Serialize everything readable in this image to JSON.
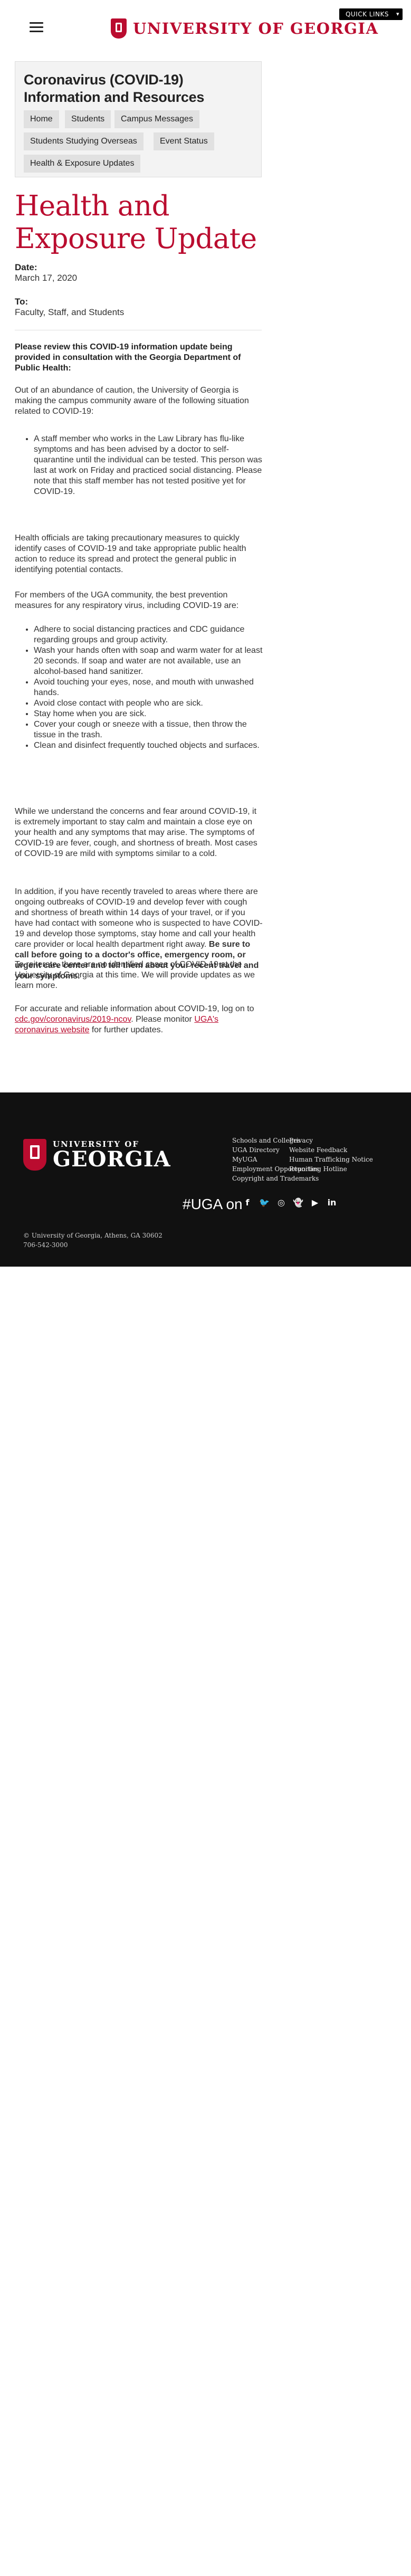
{
  "header": {
    "quick_links": "QUICK LINKS",
    "quick_links_arrow": "▾",
    "logo_text": "UNIVERSITY OF GEORGIA"
  },
  "section_nav": {
    "title": "Coronavirus (COVID-19) Information and Resources",
    "items": [
      {
        "label": "Home"
      },
      {
        "label": "Students"
      },
      {
        "label": "Campus Messages"
      },
      {
        "label": "Students Studying Overseas"
      },
      {
        "label": "Event Status"
      },
      {
        "label": "Health & Exposure Updates"
      }
    ]
  },
  "article": {
    "title": "Health and Exposure Update",
    "date_label": "Date:",
    "date_value": "March 17, 2020",
    "to_label": "To:",
    "to_value": "Faculty, Staff, and Students",
    "intro_bold": "Please review this COVID-19 information update being provided in consultation with the Georgia Department of Public Health:",
    "p1": "Out of an abundance of caution, the University of Georgia is making the campus community aware of the following situation related to COVID-19:",
    "bullet1": "A staff member who works in the Law Library has flu-like symptoms and has been advised by a doctor to self-quarantine until the individual can be tested. This person was last at work on Friday and practiced social distancing. Please note that this staff member has not tested positive yet for COVID-19.",
    "p2": "Health officials are taking precautionary measures to quickly identify cases of COVID-19 and take appropriate public health action to reduce its spread and protect the general public in identifying potential contacts.",
    "p3": "For members of the UGA community, the best prevention measures for any respiratory virus, including COVID-19 are:",
    "prevention": [
      "Adhere to social distancing practices and CDC guidance regarding groups and group activity.",
      "Wash your hands often with soap and warm water for at least 20 seconds. If soap and water are not available, use an alcohol-based hand sanitizer.",
      "Avoid touching your eyes, nose, and mouth with unwashed hands.",
      "Avoid close contact with people who are sick.",
      "Stay home when you are sick.",
      "Cover your cough or sneeze with a tissue, then throw the tissue in the trash.",
      "Clean and disinfect frequently touched objects and surfaces."
    ],
    "p4": "While we understand the concerns and fear around COVID-19, it is extremely important to stay calm and maintain a close eye on your health and any symptoms that may arise. The symptoms of COVID-19 are fever, cough, and shortness of breath. Most cases of COVID-19 are mild with symptoms similar to a cold.",
    "p5_text": "In addition, if you have recently traveled to areas where there are ongoing outbreaks of COVID-19 and develop fever with cough and shortness of breath within 14 days of your travel, or if you have had contact with someone who is suspected to have COVID-19 and develop those symptoms, stay home and call your health care provider or local health department right away. ",
    "p5_bold": "Be sure to call before going to a doctor's office, emergency room, or urgent care center and tell them about your recent travel and your symptoms.",
    "p6": "To reiterate, there are no identified cases of COVID-19 at the University of Georgia at this time. We will provide updates as we learn more.",
    "p7_a": "For accurate and reliable information about COVID-19, log on to ",
    "p7_link1": "cdc.gov/coronavirus/2019-ncov",
    "p7_b": ". Please monitor ",
    "p7_link2": "UGA's coronavirus website",
    "p7_c": " for further updates."
  },
  "footer": {
    "logo_top": "UNIVERSITY OF",
    "logo_bottom": "GEORGIA",
    "links_col1": [
      "Schools and Colleges",
      "UGA Directory",
      "MyUGA",
      "Employment Opportunities",
      "Copyright and Trademarks"
    ],
    "links_col2": [
      "Privacy",
      "Website Feedback",
      "Human Trafficking Notice",
      "Reporting Hotline"
    ],
    "uga_on": "#UGA on",
    "social_icons": [
      {
        "name": "facebook-icon",
        "glyph": "f"
      },
      {
        "name": "twitter-icon",
        "glyph": "🐦"
      },
      {
        "name": "instagram-icon",
        "glyph": "◎"
      },
      {
        "name": "snapchat-icon",
        "glyph": "👻"
      },
      {
        "name": "youtube-icon",
        "glyph": "▶"
      },
      {
        "name": "linkedin-icon",
        "glyph": "in"
      }
    ],
    "address_line1": "© University of Georgia, Athens, GA 30602",
    "address_line2": "706‑542‑3000"
  },
  "colors": {
    "accent": "#ba0c2f",
    "footer_bg": "#111111"
  }
}
